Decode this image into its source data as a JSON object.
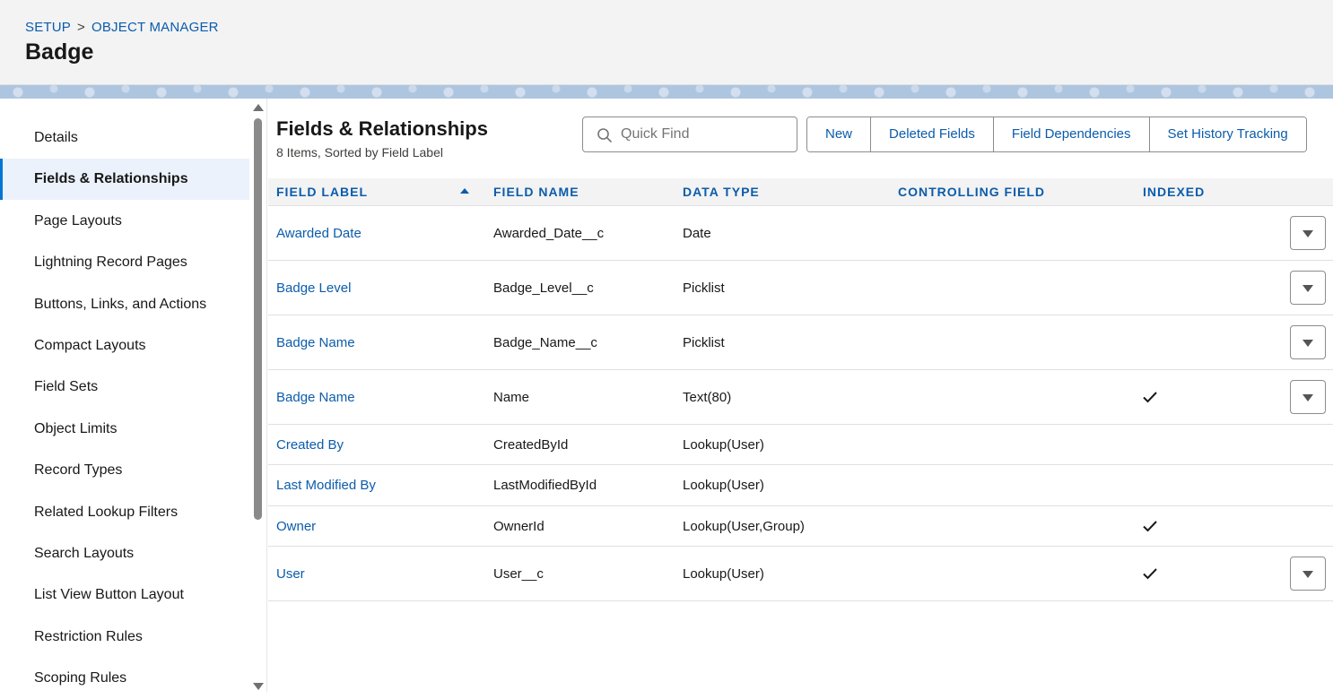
{
  "breadcrumb": {
    "setup": "SETUP",
    "separator": ">",
    "object_manager": "OBJECT MANAGER"
  },
  "page_title": "Badge",
  "sidebar": {
    "items": [
      {
        "label": "Details",
        "active": false
      },
      {
        "label": "Fields & Relationships",
        "active": true
      },
      {
        "label": "Page Layouts",
        "active": false
      },
      {
        "label": "Lightning Record Pages",
        "active": false
      },
      {
        "label": "Buttons, Links, and Actions",
        "active": false
      },
      {
        "label": "Compact Layouts",
        "active": false
      },
      {
        "label": "Field Sets",
        "active": false
      },
      {
        "label": "Object Limits",
        "active": false
      },
      {
        "label": "Record Types",
        "active": false
      },
      {
        "label": "Related Lookup Filters",
        "active": false
      },
      {
        "label": "Search Layouts",
        "active": false
      },
      {
        "label": "List View Button Layout",
        "active": false
      },
      {
        "label": "Restriction Rules",
        "active": false
      },
      {
        "label": "Scoping Rules",
        "active": false
      }
    ]
  },
  "main": {
    "title": "Fields & Relationships",
    "subtitle": "8 Items, Sorted by Field Label",
    "search": {
      "placeholder": "Quick Find",
      "value": "",
      "icon": "search-icon"
    },
    "buttons": {
      "new": "New",
      "deleted_fields": "Deleted Fields",
      "field_dependencies": "Field Dependencies",
      "set_history_tracking": "Set History Tracking"
    },
    "columns": {
      "field_label": "FIELD LABEL",
      "field_name": "FIELD NAME",
      "data_type": "DATA TYPE",
      "controlling_field": "CONTROLLING FIELD",
      "indexed": "INDEXED"
    },
    "rows": [
      {
        "label": "Awarded Date",
        "name": "Awarded_Date__c",
        "type": "Date",
        "controlling": "",
        "indexed": false,
        "menu": true
      },
      {
        "label": "Badge Level",
        "name": "Badge_Level__c",
        "type": "Picklist",
        "controlling": "",
        "indexed": false,
        "menu": true
      },
      {
        "label": "Badge Name",
        "name": "Badge_Name__c",
        "type": "Picklist",
        "controlling": "",
        "indexed": false,
        "menu": true
      },
      {
        "label": "Badge Name",
        "name": "Name",
        "type": "Text(80)",
        "controlling": "",
        "indexed": true,
        "menu": true
      },
      {
        "label": "Created By",
        "name": "CreatedById",
        "type": "Lookup(User)",
        "controlling": "",
        "indexed": false,
        "menu": false
      },
      {
        "label": "Last Modified By",
        "name": "LastModifiedById",
        "type": "Lookup(User)",
        "controlling": "",
        "indexed": false,
        "menu": false
      },
      {
        "label": "Owner",
        "name": "OwnerId",
        "type": "Lookup(User,Group)",
        "controlling": "",
        "indexed": true,
        "menu": false
      },
      {
        "label": "User",
        "name": "User__c",
        "type": "Lookup(User)",
        "controlling": "",
        "indexed": true,
        "menu": true
      }
    ]
  },
  "colors": {
    "link": "#0b5cab",
    "active_bg": "#ebf2fb",
    "header_bg": "#f3f3f3",
    "band": "#aec5e0"
  }
}
